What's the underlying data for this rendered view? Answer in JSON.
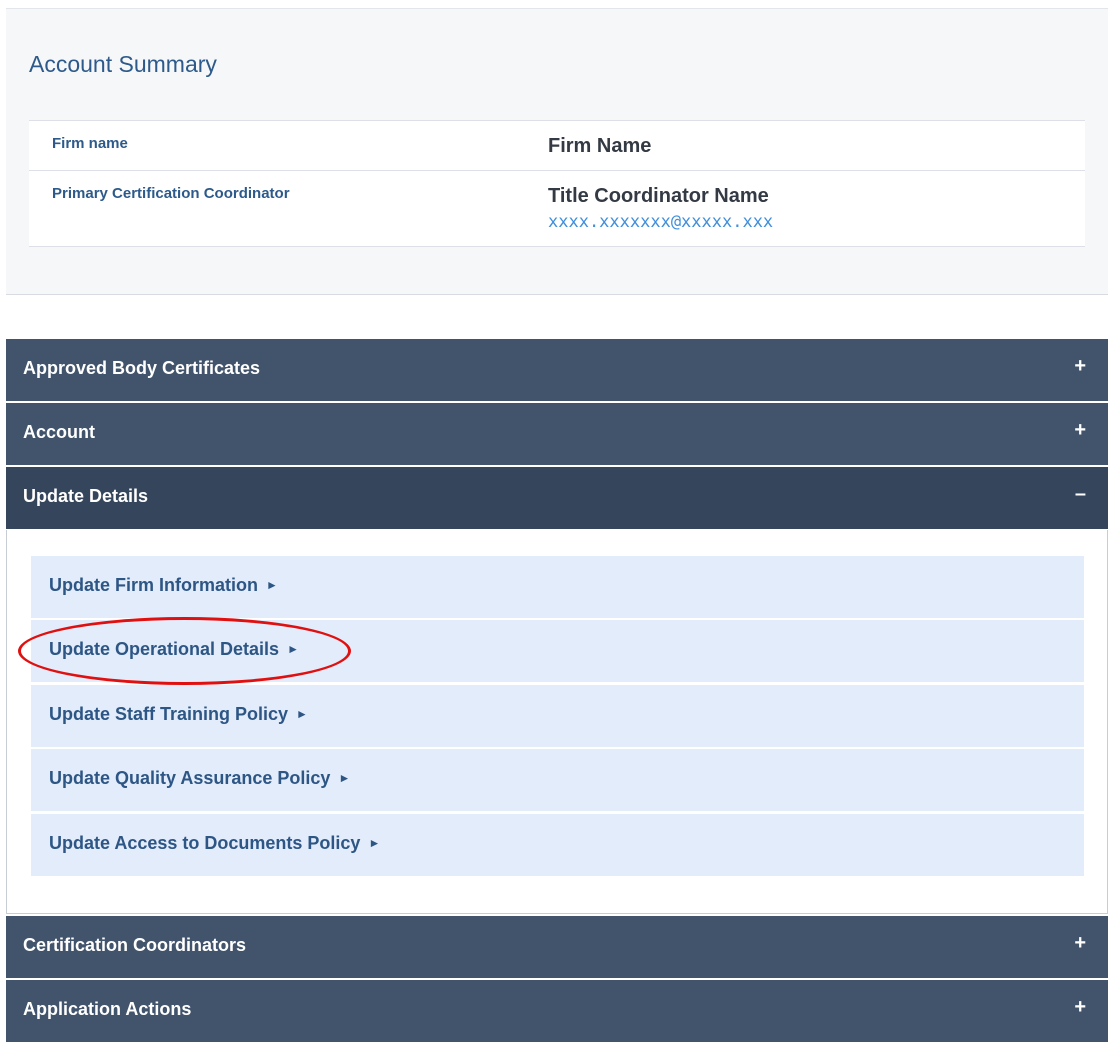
{
  "summary": {
    "title": "Account Summary",
    "rows": [
      {
        "label": "Firm name",
        "value": "Firm Name"
      },
      {
        "label": "Primary Certification Coordinator",
        "value": "Title Coordinator Name",
        "email": "xxxx.xxxxxxx@xxxxx.xxx"
      }
    ]
  },
  "accordion": {
    "collapsed_icon": "+",
    "expanded_icon": "–",
    "sections": [
      {
        "title": "Approved Body Certificates",
        "expanded": false
      },
      {
        "title": "Account",
        "expanded": false
      },
      {
        "title": "Update Details",
        "expanded": true
      },
      {
        "title": "Certification Coordinators",
        "expanded": false
      },
      {
        "title": "Application Actions",
        "expanded": false
      }
    ],
    "update_details_items": [
      {
        "label": "Update Firm Information"
      },
      {
        "label": "Update Operational Details",
        "highlighted": true
      },
      {
        "label": "Update Staff Training Policy"
      },
      {
        "label": "Update Quality Assurance Policy"
      },
      {
        "label": "Update Access to Documents Policy"
      }
    ],
    "item_arrow": "►",
    "highlight_color": "#e01010"
  }
}
